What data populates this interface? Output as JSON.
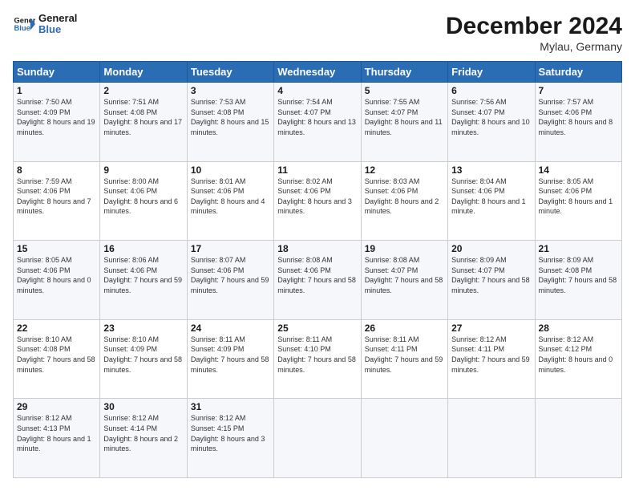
{
  "logo": {
    "line1": "General",
    "line2": "Blue"
  },
  "header": {
    "month": "December 2024",
    "location": "Mylau, Germany"
  },
  "days_of_week": [
    "Sunday",
    "Monday",
    "Tuesday",
    "Wednesday",
    "Thursday",
    "Friday",
    "Saturday"
  ],
  "weeks": [
    [
      {
        "day": "1",
        "sunrise": "Sunrise: 7:50 AM",
        "sunset": "Sunset: 4:09 PM",
        "daylight": "Daylight: 8 hours and 19 minutes."
      },
      {
        "day": "2",
        "sunrise": "Sunrise: 7:51 AM",
        "sunset": "Sunset: 4:08 PM",
        "daylight": "Daylight: 8 hours and 17 minutes."
      },
      {
        "day": "3",
        "sunrise": "Sunrise: 7:53 AM",
        "sunset": "Sunset: 4:08 PM",
        "daylight": "Daylight: 8 hours and 15 minutes."
      },
      {
        "day": "4",
        "sunrise": "Sunrise: 7:54 AM",
        "sunset": "Sunset: 4:07 PM",
        "daylight": "Daylight: 8 hours and 13 minutes."
      },
      {
        "day": "5",
        "sunrise": "Sunrise: 7:55 AM",
        "sunset": "Sunset: 4:07 PM",
        "daylight": "Daylight: 8 hours and 11 minutes."
      },
      {
        "day": "6",
        "sunrise": "Sunrise: 7:56 AM",
        "sunset": "Sunset: 4:07 PM",
        "daylight": "Daylight: 8 hours and 10 minutes."
      },
      {
        "day": "7",
        "sunrise": "Sunrise: 7:57 AM",
        "sunset": "Sunset: 4:06 PM",
        "daylight": "Daylight: 8 hours and 8 minutes."
      }
    ],
    [
      {
        "day": "8",
        "sunrise": "Sunrise: 7:59 AM",
        "sunset": "Sunset: 4:06 PM",
        "daylight": "Daylight: 8 hours and 7 minutes."
      },
      {
        "day": "9",
        "sunrise": "Sunrise: 8:00 AM",
        "sunset": "Sunset: 4:06 PM",
        "daylight": "Daylight: 8 hours and 6 minutes."
      },
      {
        "day": "10",
        "sunrise": "Sunrise: 8:01 AM",
        "sunset": "Sunset: 4:06 PM",
        "daylight": "Daylight: 8 hours and 4 minutes."
      },
      {
        "day": "11",
        "sunrise": "Sunrise: 8:02 AM",
        "sunset": "Sunset: 4:06 PM",
        "daylight": "Daylight: 8 hours and 3 minutes."
      },
      {
        "day": "12",
        "sunrise": "Sunrise: 8:03 AM",
        "sunset": "Sunset: 4:06 PM",
        "daylight": "Daylight: 8 hours and 2 minutes."
      },
      {
        "day": "13",
        "sunrise": "Sunrise: 8:04 AM",
        "sunset": "Sunset: 4:06 PM",
        "daylight": "Daylight: 8 hours and 1 minute."
      },
      {
        "day": "14",
        "sunrise": "Sunrise: 8:05 AM",
        "sunset": "Sunset: 4:06 PM",
        "daylight": "Daylight: 8 hours and 1 minute."
      }
    ],
    [
      {
        "day": "15",
        "sunrise": "Sunrise: 8:05 AM",
        "sunset": "Sunset: 4:06 PM",
        "daylight": "Daylight: 8 hours and 0 minutes."
      },
      {
        "day": "16",
        "sunrise": "Sunrise: 8:06 AM",
        "sunset": "Sunset: 4:06 PM",
        "daylight": "Daylight: 7 hours and 59 minutes."
      },
      {
        "day": "17",
        "sunrise": "Sunrise: 8:07 AM",
        "sunset": "Sunset: 4:06 PM",
        "daylight": "Daylight: 7 hours and 59 minutes."
      },
      {
        "day": "18",
        "sunrise": "Sunrise: 8:08 AM",
        "sunset": "Sunset: 4:06 PM",
        "daylight": "Daylight: 7 hours and 58 minutes."
      },
      {
        "day": "19",
        "sunrise": "Sunrise: 8:08 AM",
        "sunset": "Sunset: 4:07 PM",
        "daylight": "Daylight: 7 hours and 58 minutes."
      },
      {
        "day": "20",
        "sunrise": "Sunrise: 8:09 AM",
        "sunset": "Sunset: 4:07 PM",
        "daylight": "Daylight: 7 hours and 58 minutes."
      },
      {
        "day": "21",
        "sunrise": "Sunrise: 8:09 AM",
        "sunset": "Sunset: 4:08 PM",
        "daylight": "Daylight: 7 hours and 58 minutes."
      }
    ],
    [
      {
        "day": "22",
        "sunrise": "Sunrise: 8:10 AM",
        "sunset": "Sunset: 4:08 PM",
        "daylight": "Daylight: 7 hours and 58 minutes."
      },
      {
        "day": "23",
        "sunrise": "Sunrise: 8:10 AM",
        "sunset": "Sunset: 4:09 PM",
        "daylight": "Daylight: 7 hours and 58 minutes."
      },
      {
        "day": "24",
        "sunrise": "Sunrise: 8:11 AM",
        "sunset": "Sunset: 4:09 PM",
        "daylight": "Daylight: 7 hours and 58 minutes."
      },
      {
        "day": "25",
        "sunrise": "Sunrise: 8:11 AM",
        "sunset": "Sunset: 4:10 PM",
        "daylight": "Daylight: 7 hours and 58 minutes."
      },
      {
        "day": "26",
        "sunrise": "Sunrise: 8:11 AM",
        "sunset": "Sunset: 4:11 PM",
        "daylight": "Daylight: 7 hours and 59 minutes."
      },
      {
        "day": "27",
        "sunrise": "Sunrise: 8:12 AM",
        "sunset": "Sunset: 4:11 PM",
        "daylight": "Daylight: 7 hours and 59 minutes."
      },
      {
        "day": "28",
        "sunrise": "Sunrise: 8:12 AM",
        "sunset": "Sunset: 4:12 PM",
        "daylight": "Daylight: 8 hours and 0 minutes."
      }
    ],
    [
      {
        "day": "29",
        "sunrise": "Sunrise: 8:12 AM",
        "sunset": "Sunset: 4:13 PM",
        "daylight": "Daylight: 8 hours and 1 minute."
      },
      {
        "day": "30",
        "sunrise": "Sunrise: 8:12 AM",
        "sunset": "Sunset: 4:14 PM",
        "daylight": "Daylight: 8 hours and 2 minutes."
      },
      {
        "day": "31",
        "sunrise": "Sunrise: 8:12 AM",
        "sunset": "Sunset: 4:15 PM",
        "daylight": "Daylight: 8 hours and 3 minutes."
      },
      null,
      null,
      null,
      null
    ]
  ]
}
